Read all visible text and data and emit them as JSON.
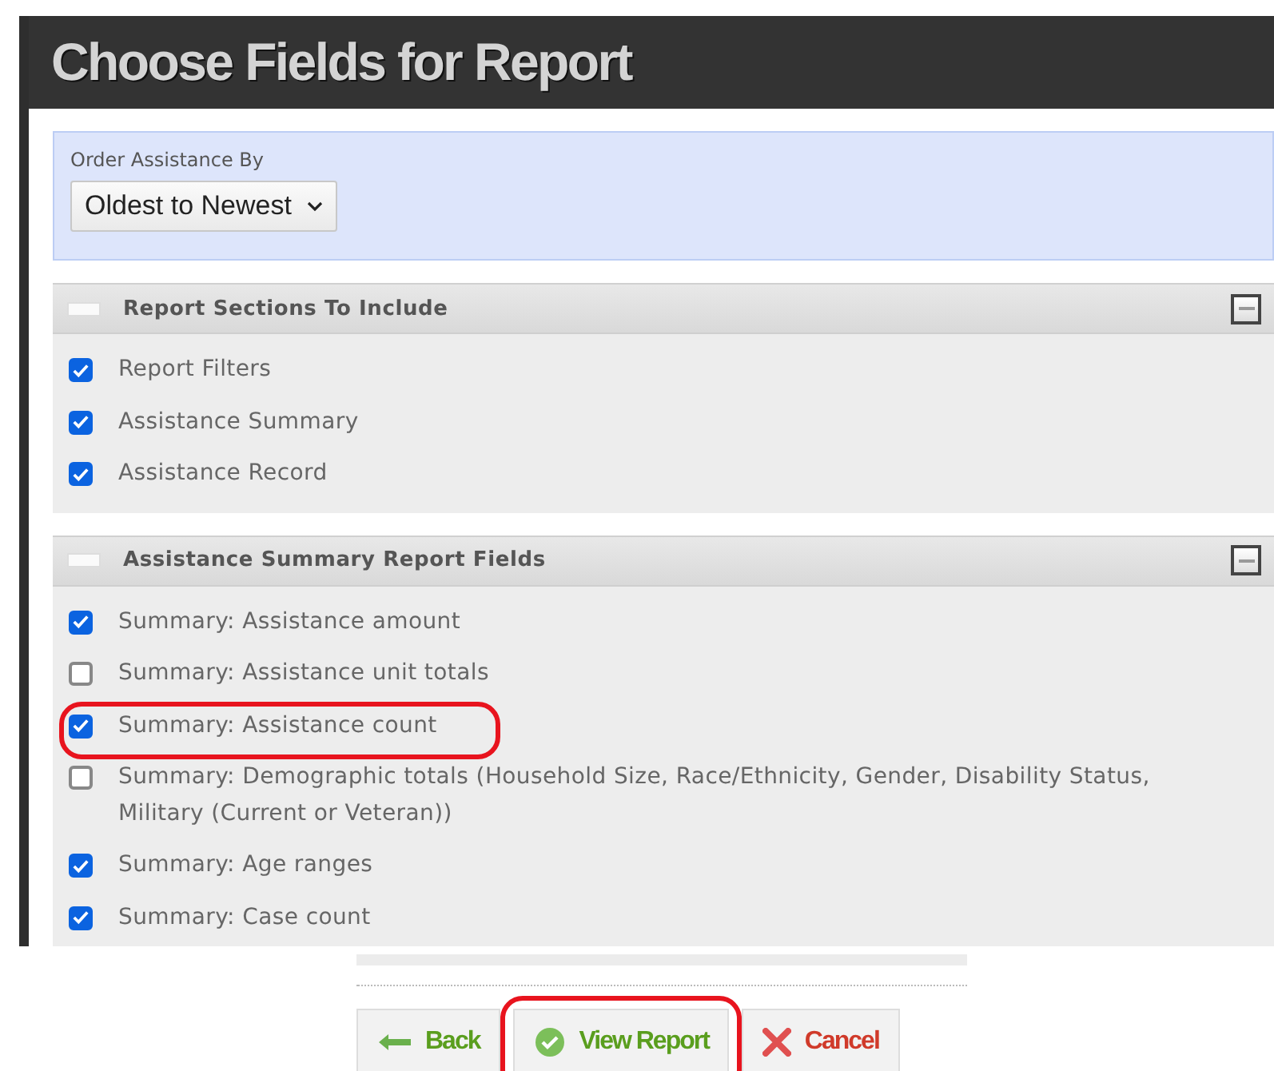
{
  "window": {
    "title": "Choose Fields for Report"
  },
  "order_by": {
    "label": "Order Assistance By",
    "value": "Oldest to Newest"
  },
  "sections": [
    {
      "title": "Report Sections To Include",
      "expanded": true,
      "items": [
        {
          "label": "Report Filters",
          "checked": true,
          "highlighted": false
        },
        {
          "label": "Assistance Summary",
          "checked": true,
          "highlighted": false
        },
        {
          "label": "Assistance Record",
          "checked": true,
          "highlighted": false
        }
      ]
    },
    {
      "title": "Assistance Summary Report Fields",
      "expanded": true,
      "items": [
        {
          "label": "Summary: Assistance amount",
          "checked": true,
          "highlighted": false
        },
        {
          "label": "Summary: Assistance unit totals",
          "checked": false,
          "highlighted": false
        },
        {
          "label": "Summary: Assistance count",
          "checked": true,
          "highlighted": true
        },
        {
          "label": "Summary: Demographic totals (Household Size, Race/Ethnicity, Gender, Disability Status, Military (Current or Veteran))",
          "checked": false,
          "highlighted": false
        },
        {
          "label": "Summary: Age ranges",
          "checked": true,
          "highlighted": false
        },
        {
          "label": "Summary: Case count",
          "checked": true,
          "highlighted": false
        }
      ]
    }
  ],
  "buttons": [
    {
      "label": "Back",
      "kind": "back",
      "highlighted": false
    },
    {
      "label": "View Report",
      "kind": "view",
      "highlighted": true
    },
    {
      "label": "Cancel",
      "kind": "cancel",
      "highlighted": false
    }
  ]
}
